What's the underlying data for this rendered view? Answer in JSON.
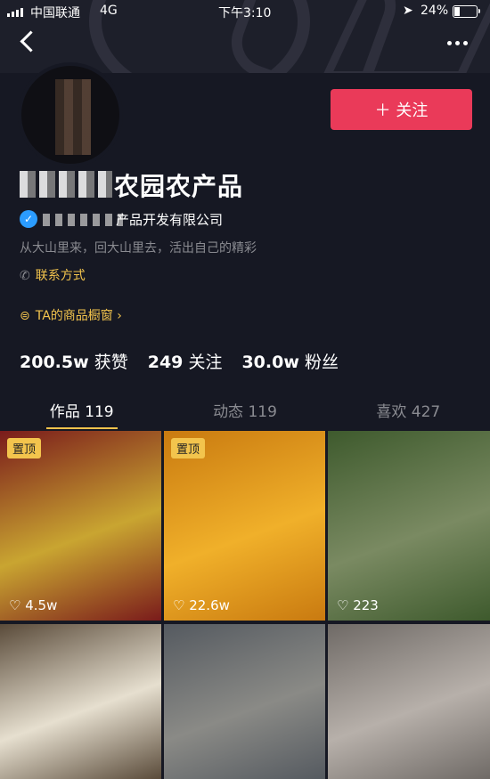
{
  "status_bar": {
    "carrier": "中国联通",
    "network": "4G",
    "time": "下午3:10",
    "battery": "24%"
  },
  "profile": {
    "name_visible": "农园农产品",
    "company_visible": "产品开发有限公司",
    "bio": "从大山里来，回大山里去，活出自己的精彩",
    "contact_label": "联系方式",
    "shop_label": "TA的商品橱窗 ›",
    "follow_button": "＋ 关注"
  },
  "stats": [
    {
      "value": "200.5w",
      "label": "获赞"
    },
    {
      "value": "249",
      "label": "关注"
    },
    {
      "value": "30.0w",
      "label": "粉丝"
    }
  ],
  "tabs": [
    {
      "label": "作品 119",
      "active": true
    },
    {
      "label": "动态 119",
      "active": false
    },
    {
      "label": "喜欢 427",
      "active": false
    }
  ],
  "videos": [
    {
      "pinned_label": "置顶",
      "likes": "4.5w",
      "colors": [
        "#7a1b1b",
        "#c9a531"
      ]
    },
    {
      "pinned_label": "置顶",
      "likes": "22.6w",
      "colors": [
        "#c97a10",
        "#f0b02a"
      ]
    },
    {
      "pinned_label": "",
      "likes": "223",
      "colors": [
        "#3e5a2d",
        "#7a8a62"
      ]
    },
    {
      "pinned_label": "",
      "likes": "",
      "colors": [
        "#5a4b3a",
        "#e6dfcf"
      ]
    },
    {
      "pinned_label": "",
      "likes": "",
      "colors": [
        "#555a60",
        "#8a8a86"
      ]
    },
    {
      "pinned_label": "",
      "likes": "",
      "colors": [
        "#6f6a66",
        "#b7b0aa"
      ]
    }
  ]
}
